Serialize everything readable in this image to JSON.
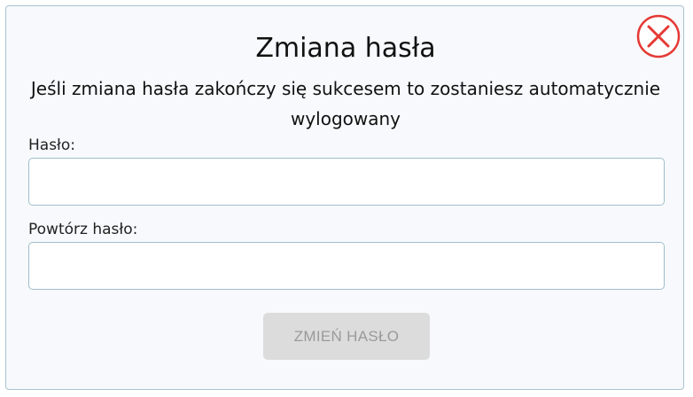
{
  "dialog": {
    "title": "Zmiana hasła",
    "message": "Jeśli zmiana hasła zakończy się sukcesem to zostaniesz automatycznie wylogowany",
    "close_icon": "close-circle-icon",
    "accent_color": "#e53935"
  },
  "form": {
    "password_label": "Hasło:",
    "password_value": "",
    "repeat_password_label": "Powtórz hasło:",
    "repeat_password_value": "",
    "submit_label": "ZMIEŃ HASŁO",
    "submit_enabled": false
  }
}
